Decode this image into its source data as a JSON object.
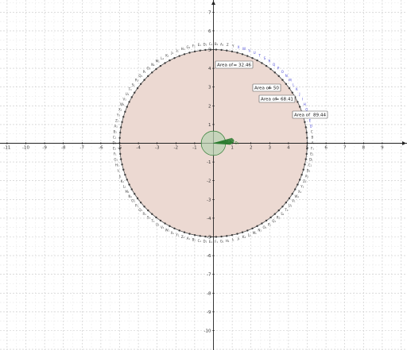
{
  "colors": {
    "grid_major": "#c8c8c8",
    "grid_minor": "#e6e6e6",
    "axis": "#222222",
    "circle_fill": "#ecd9d2",
    "circle_stroke": "#555555",
    "points": "#3a3a3a",
    "labels_dark": "#444444",
    "labels_blue": "#4a4ad8",
    "inner_fill": "#b7d2b0",
    "inner_stroke": "#2e7d32",
    "green_labels": "#2e8b2e"
  },
  "axes": {
    "x_range": [
      -11,
      9
    ],
    "y_range": [
      -10,
      7
    ],
    "x_ticks": [
      "-11",
      "-10",
      "-9",
      "-8",
      "-7",
      "-6",
      "-5",
      "-4",
      "-3",
      "-2",
      "-1",
      "1",
      "2",
      "3",
      "4",
      "5",
      "6",
      "7",
      "8",
      "9"
    ],
    "y_ticks": [
      "7",
      "6",
      "5",
      "4",
      "3",
      "2",
      "1",
      "-1",
      "-2",
      "-3",
      "-4",
      "-5",
      "-6",
      "-7",
      "-8",
      "-9",
      "-10"
    ]
  },
  "circle": {
    "radius": 5,
    "center": [
      0,
      0
    ],
    "point_count": 110
  },
  "inner_circle": {
    "radius": 0.5
  },
  "area_labels": [
    {
      "id": "area-32",
      "prefix": "Area of",
      "value": "= 32.46"
    },
    {
      "id": "area-50",
      "prefix": "Area of",
      "value": "= 50"
    },
    {
      "id": "area-68",
      "prefix": "Area of",
      "value": "= 68.41"
    },
    {
      "id": "area-89",
      "prefix": "Area of",
      "value": "89.44"
    }
  ],
  "point_labels_top": [
    "D₁",
    "B₁",
    "C₁",
    "H₁",
    "K₁",
    "A₁",
    "F₁",
    "G₁"
  ],
  "green_label": "D₁"
}
